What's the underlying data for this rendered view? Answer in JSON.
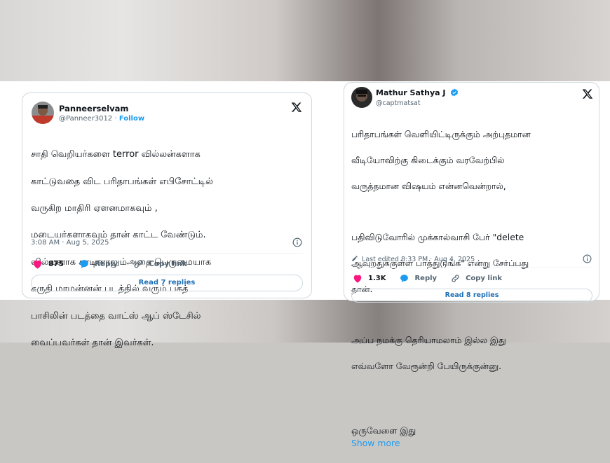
{
  "left_tweet": {
    "name": "Panneerselvam",
    "handle": "@Panneer3012",
    "follow_sep": "·",
    "follow": "Follow",
    "body_lines": [
      "சாதி வெறியர்களை terror வில்லன்களாக",
      "காட்டுவதை விட பரிதாபங்கள் எபிசோட்டில்",
      "வருகிற மாதிரி ஏளனமாகவும் ,",
      "மடையர்களாகவும் தான் காட்ட வேண்டும்.",
      "வில்லனாக காடினாலும்அதை பெருமையாக",
      "கருதி மாமன்னன் படத்தில் வரும் பகத்",
      "பாசிலின் படத்தை வாட்ஸ் ஆப் ஸ்டேசில்",
      "வைப்பவர்கள் தான் இவர்கள்."
    ],
    "timestamp": "3:08 AM · Aug 5, 2025",
    "likes": "875",
    "reply_label": "Reply",
    "copy_label": "Copy link",
    "read_replies": "Read 7 replies"
  },
  "right_tweet": {
    "name": "Mathur Sathya J",
    "handle": "@captmatsat",
    "para1": [
      "பரிதாபங்கள் வெளியிட்டிருக்கும் அற்புதமான",
      "வீடியோவிற்கு கிடைக்கும் வரவேற்பில்",
      "வருத்தமான விஷயம் என்னவென்றால்,"
    ],
    "para2": [
      "பதிவிடுவோரில் முக்கால்வாசி பேர் \"delete",
      "ஆவுறதுக்குள்ள பாத்துடுங்க\" என்று சேர்ப்பது",
      "தான்."
    ],
    "para3": [
      "அப்ப நமக்கு தெரியாமலாம் இல்ல இது",
      "எவ்வளோ வேரூன்றி பேயிருக்குன்னு."
    ],
    "last_line": "ஒருவேளை இது",
    "show_more": "Show more",
    "edited": "Last edited 8:33 PM · Aug 4, 2025",
    "likes": "1.3K",
    "reply_label": "Reply",
    "copy_label": "Copy link",
    "read_replies": "Read 8 replies"
  },
  "colors": {
    "accent": "#1d9bf0",
    "heart": "#f91880",
    "text": "#0f1419",
    "muted": "#536471"
  }
}
